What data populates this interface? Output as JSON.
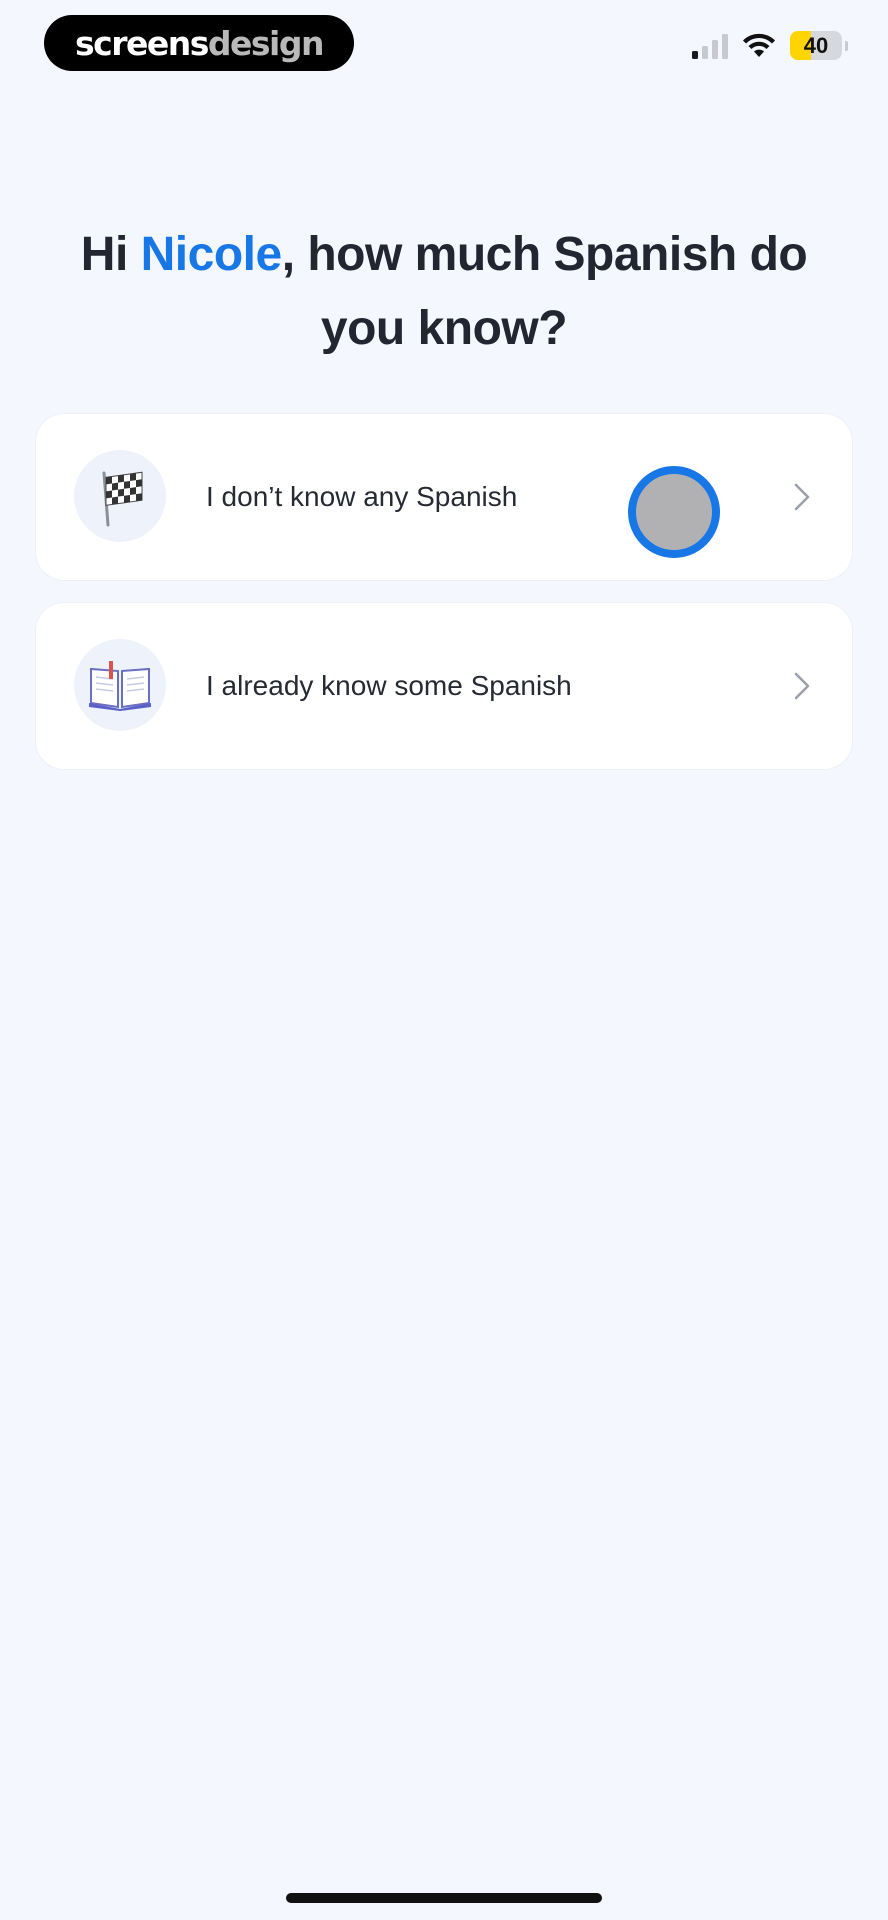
{
  "status_bar": {
    "brand_part1": "screens",
    "brand_part2": "design",
    "battery_level": "40",
    "battery_fill_percent": 40,
    "icons": [
      "signal-icon",
      "wifi-icon",
      "battery-icon"
    ]
  },
  "heading": {
    "greeting": "Hi ",
    "name": "Nicole",
    "question": ", how much Spanish do you know?"
  },
  "options": [
    {
      "label": "I don’t know any Spanish",
      "icon": "checkered-flag-icon"
    },
    {
      "label": "I already know some Spanish",
      "icon": "open-book-icon"
    }
  ],
  "colors": {
    "accent": "#1877e6",
    "background": "#f4f7fe",
    "card": "#ffffff",
    "battery": "#ffd400"
  }
}
